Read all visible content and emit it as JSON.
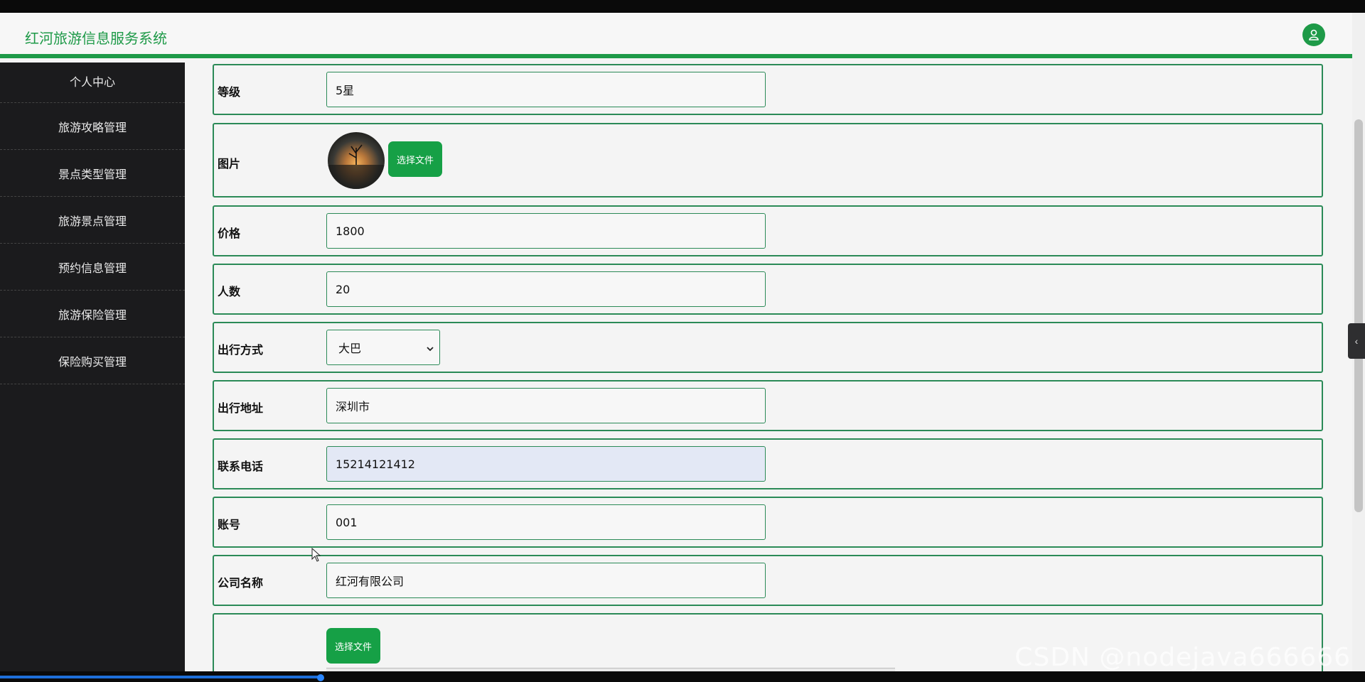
{
  "app": {
    "brand": "红河旅游信息服务系统",
    "accent": "#1e9a48"
  },
  "sidebar": {
    "items": [
      {
        "label": "个人中心"
      },
      {
        "label": "旅游攻略管理"
      },
      {
        "label": "景点类型管理"
      },
      {
        "label": "旅游景点管理"
      },
      {
        "label": "预约信息管理"
      },
      {
        "label": "旅游保险管理"
      },
      {
        "label": "保险购买管理"
      }
    ]
  },
  "form": {
    "level": {
      "label": "等级",
      "value": "5星"
    },
    "image": {
      "label": "图片",
      "button": "选择文件"
    },
    "price": {
      "label": "价格",
      "value": "1800"
    },
    "people": {
      "label": "人数",
      "value": "20"
    },
    "travel_mode": {
      "label": "出行方式",
      "value": "大巴"
    },
    "travel_address": {
      "label": "出行地址",
      "value": "深圳市"
    },
    "phone": {
      "label": "联系电话",
      "value": "15214121412"
    },
    "account": {
      "label": "账号",
      "value": "001"
    },
    "company": {
      "label": "公司名称",
      "value": "红河有限公司"
    },
    "details": {
      "button": "选择文件"
    }
  },
  "watermark": "CSDN @nodejava666666"
}
